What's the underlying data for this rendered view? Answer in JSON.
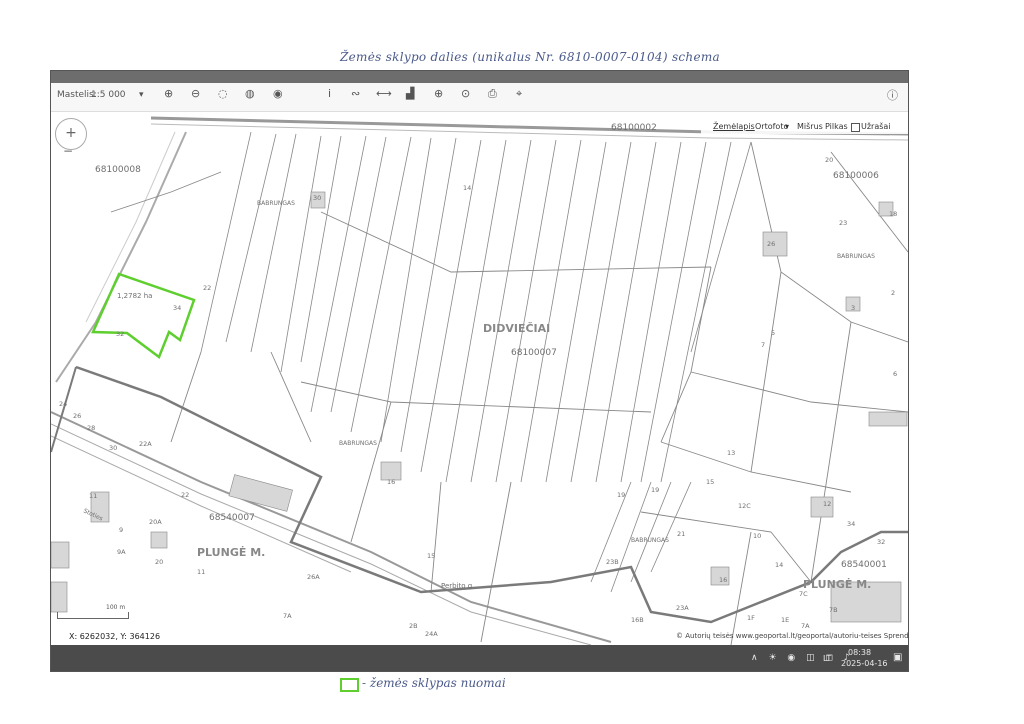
{
  "handwritten": {
    "title": "Žemės sklypo dalies (unikalus Nr. 6810-0007-0104) schema",
    "legend": "- žemės sklypas nuomai"
  },
  "toolbar": {
    "scale_label": "Mastelis:",
    "scale_value": "1:5 000"
  },
  "map": {
    "layers": {
      "zemelapis": "Žemėlapis",
      "ortofoto": "Ortofoto",
      "misrus": "Mišrus",
      "pilkas": "Pilkas",
      "uzrasai": "Užrašai"
    },
    "place_labels": {
      "didvieciai": "DIDVIEČIAI",
      "plunge_m_left": "PLUNGĖ M.",
      "plunge_m_right": "PLUNGĖ M.",
      "babrungas_1": "BABRUNGAS",
      "babrungas_2": "BABRUNGAS",
      "babrungas_3": "BABRUNGAS",
      "babrungas_4": "BABRUNGAS",
      "street_perbito": "Perbito g.",
      "street_stotis": "Stoties"
    },
    "cadastral_codes": {
      "c68100008": "68100008",
      "c68100002": "68100002",
      "c68100006": "68100006",
      "c68100007": "68100007",
      "c68540007": "68540007",
      "c68540001": "68540001"
    },
    "parcel_numbers": {
      "p32": "32",
      "p34": "34",
      "p22": "22",
      "p30": "30",
      "p14": "14",
      "p20": "20",
      "p23": "23",
      "p18": "18",
      "p26": "26",
      "p2": "2",
      "p3": "3",
      "p5": "5",
      "p7": "7",
      "p6": "6",
      "p13": "13",
      "p15": "15",
      "p12C": "12C",
      "p19": "19",
      "p21": "21",
      "p23B": "23B",
      "p16": "16",
      "p23A": "23A",
      "p16B": "16B",
      "p1F": "1F",
      "p1E": "1E",
      "p7A": "7A",
      "p7B": "7B",
      "p7C": "7C",
      "p34b": "34",
      "p32b": "32",
      "p24": "24",
      "p26b": "26",
      "p28": "28",
      "p30b": "30",
      "p22A": "22A",
      "p22b": "22",
      "p11": "11",
      "p20A": "20A",
      "p9": "9",
      "p9A": "9A",
      "p20b": "20",
      "p11b": "11",
      "p26A": "26A",
      "p7Ab": "7A",
      "p2B": "2B",
      "p24A": "24A",
      "p12": "12",
      "p10": "10",
      "p16c": "16",
      "p15b": "15",
      "p14b": "14",
      "p19b": "19"
    },
    "area_note": "1,2782 ha",
    "scalebar": "100 m",
    "coordinates": "X: 6262032, Y: 364126",
    "copyright": "© Autorių teisės www.geoportal.lt/geoportal/autoriu-teises  Sprendimas"
  },
  "taskbar": {
    "time": "08:38",
    "date": "2025-04-16",
    "lang": "LT"
  },
  "colors": {
    "parcel_outline": "#5fcf2f",
    "boundary": "#7a7a7a",
    "taskbar": "#4b4b4b"
  },
  "icons": [
    "zoom-in-icon",
    "zoom-out-icon",
    "globe-icon",
    "layers-icon",
    "target-icon",
    "info-icon",
    "link-icon",
    "measure-icon",
    "chart-icon",
    "plus-icon",
    "print-icon",
    "printer-icon",
    "crosshair-icon",
    "info-circle-icon"
  ]
}
